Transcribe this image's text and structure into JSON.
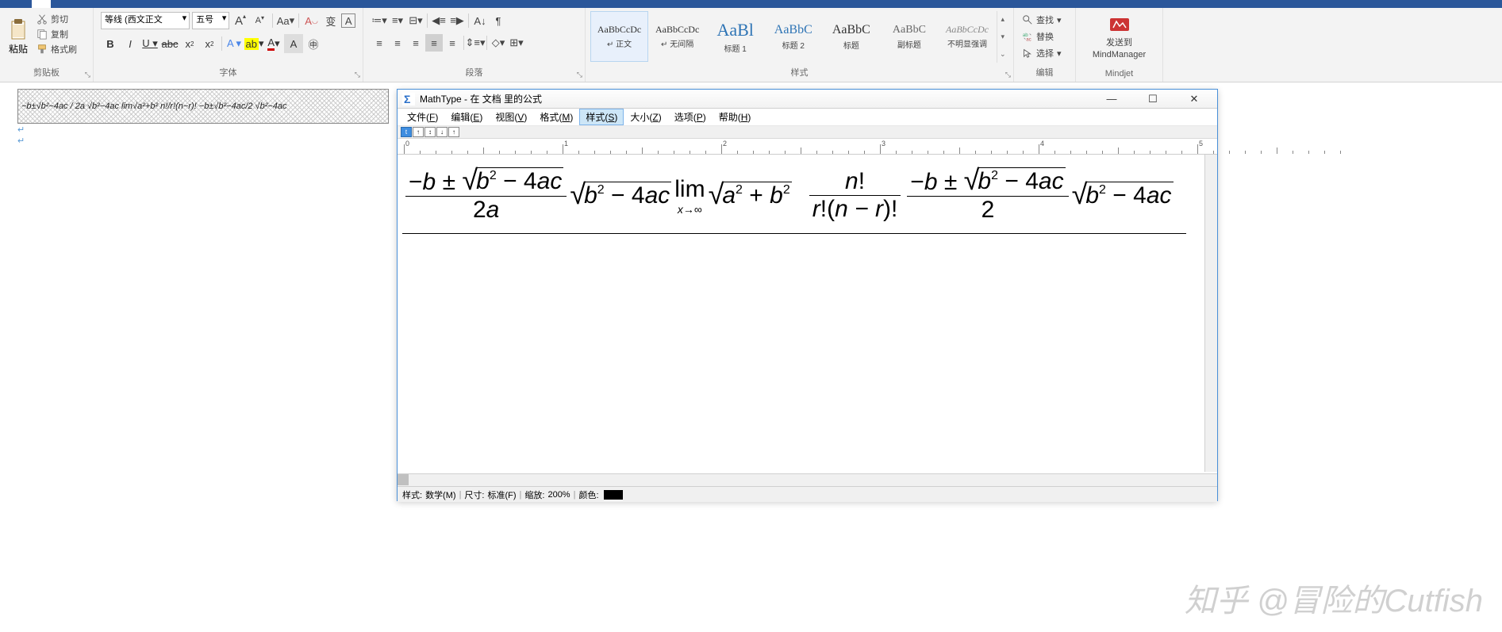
{
  "ribbon": {
    "clipboard": {
      "label": "剪贴板",
      "paste": "粘贴",
      "cut": "剪切",
      "copy": "复制",
      "format_painter": "格式刷"
    },
    "font": {
      "label": "字体",
      "font_name": "等线 (西文正文",
      "font_size": "五号",
      "grow": "A",
      "shrink": "A",
      "change_case": "Aa",
      "clear": "A"
    },
    "paragraph": {
      "label": "段落"
    },
    "styles": {
      "label": "样式",
      "items": [
        {
          "preview": "AaBbCcDc",
          "label": "↵ 正文",
          "size": "12px"
        },
        {
          "preview": "AaBbCcDc",
          "label": "↵ 无间隔",
          "size": "12px"
        },
        {
          "preview": "AaBl",
          "label": "标题 1",
          "size": "22px",
          "color": "#2e74b5"
        },
        {
          "preview": "AaBbC",
          "label": "标题 2",
          "size": "16px",
          "color": "#2e74b5"
        },
        {
          "preview": "AaBbC",
          "label": "标题",
          "size": "16px"
        },
        {
          "preview": "AaBbC",
          "label": "副标题",
          "size": "14px",
          "color": "#666"
        },
        {
          "preview": "AaBbCcDc",
          "label": "不明显强调",
          "size": "12px",
          "italic": true,
          "color": "#888"
        }
      ]
    },
    "editing": {
      "label": "编辑",
      "find": "查找",
      "replace": "替换",
      "select": "选择"
    },
    "mindmanager": {
      "label": "Mindjet",
      "send": "发送到",
      "app": "MindManager"
    }
  },
  "document": {
    "equation_text": "−b±√b²−4ac / 2a  √b²−4ac  lim√a²+b²  n!/r!(n−r)!  −b±√b²−4ac/2  √b²−4ac"
  },
  "mathtype": {
    "title": "MathType - 在 文档 里的公式",
    "menu": [
      "文件(F)",
      "编辑(E)",
      "视图(V)",
      "格式(M)",
      "样式(S)",
      "大小(Z)",
      "选项(P)",
      "帮助(H)"
    ],
    "menu_selected": 4,
    "ruler_marks": [
      "0",
      "1",
      "2",
      "3",
      "4",
      "5"
    ],
    "status": {
      "style_label": "样式:",
      "style_value": "数学(M)",
      "size_label": "尺寸:",
      "size_value": "标准(F)",
      "zoom_label": "缩放:",
      "zoom_value": "200%",
      "color_label": "颜色:"
    },
    "equation": {
      "frac1": {
        "num_a": "−",
        "num_b": "b",
        "num_pm": "±",
        "sqrt_b": "b",
        "sqrt_rest": "− 4",
        "sqrt_a": "a",
        "sqrt_c": "c",
        "den": "2",
        "den_a": "a"
      },
      "sqrt2": {
        "b": "b",
        "rest": "− 4",
        "a": "a",
        "c": "c"
      },
      "lim": {
        "op": "lim",
        "sub_x": "x",
        "sub_arrow": "→∞",
        "a": "a",
        "plus": "+",
        "b": "b"
      },
      "comb": {
        "n": "n",
        "bang": "!",
        "r": "r",
        "nmr": "n − r"
      },
      "frac5": {
        "num_a": "−",
        "num_b": "b",
        "num_pm": "±",
        "sqrt_b": "b",
        "sqrt_rest": "− 4",
        "sqrt_a": "a",
        "sqrt_c": "c",
        "den": "2"
      },
      "sqrt6": {
        "b": "b",
        "rest": "− 4",
        "a": "a",
        "c": "c"
      }
    }
  },
  "watermark": "知乎 @冒险的Cutfish"
}
